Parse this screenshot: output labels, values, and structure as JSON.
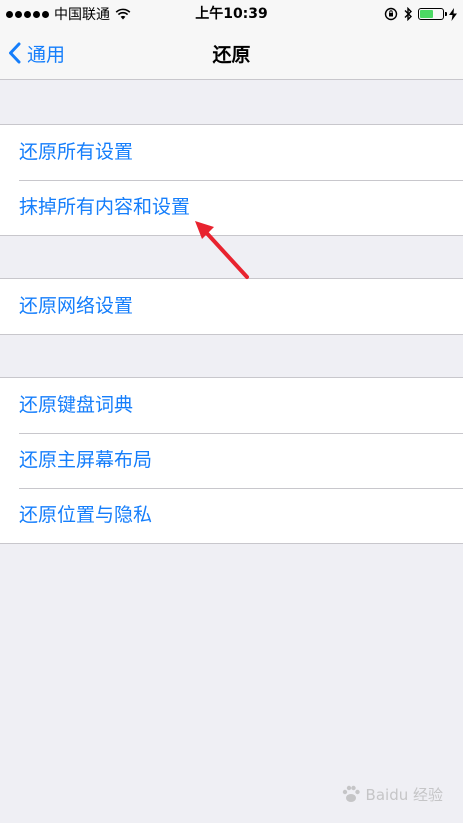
{
  "status_bar": {
    "carrier": "中国联通",
    "time": "上午10:39"
  },
  "nav": {
    "back_label": "通用",
    "title": "还原"
  },
  "groups": [
    {
      "items": [
        "还原所有设置",
        "抹掉所有内容和设置"
      ]
    },
    {
      "items": [
        "还原网络设置"
      ]
    },
    {
      "items": [
        "还原键盘词典",
        "还原主屏幕布局",
        "还原位置与隐私"
      ]
    }
  ],
  "watermark": "Baidu 经验",
  "colors": {
    "accent": "#157efb",
    "background": "#efeff4",
    "annotation": "#e8232f"
  }
}
